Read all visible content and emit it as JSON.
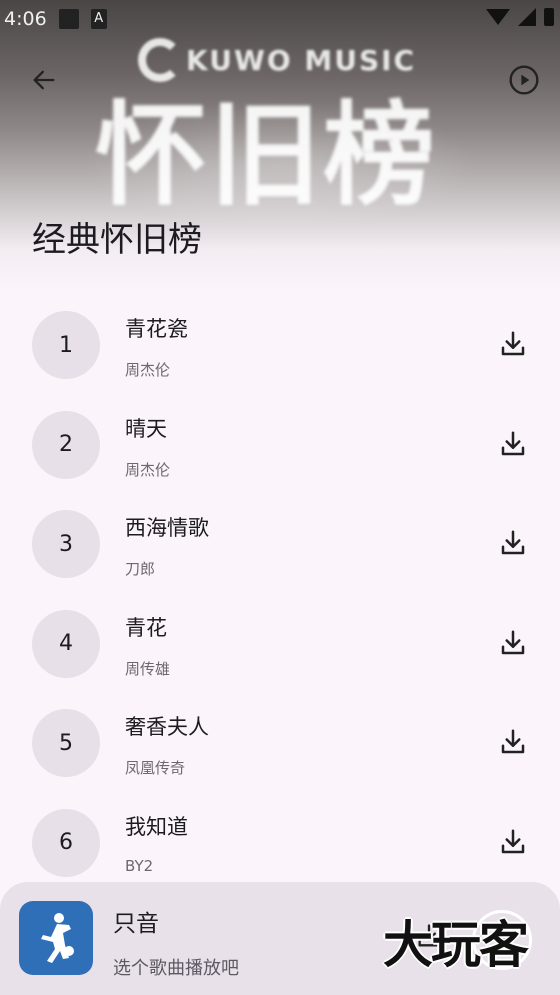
{
  "status_bar": {
    "time": "4:06"
  },
  "banner": {
    "brand": "KUWO MUSIC",
    "art_text": "怀旧榜"
  },
  "page_title": "经典怀旧榜",
  "songs": [
    {
      "rank": "1",
      "title": "青花瓷",
      "artist": "周杰伦"
    },
    {
      "rank": "2",
      "title": "晴天",
      "artist": "周杰伦"
    },
    {
      "rank": "3",
      "title": "西海情歌",
      "artist": "刀郎"
    },
    {
      "rank": "4",
      "title": "青花",
      "artist": "周传雄"
    },
    {
      "rank": "5",
      "title": "奢香夫人",
      "artist": "凤凰传奇"
    },
    {
      "rank": "6",
      "title": "我知道",
      "artist": "BY2"
    }
  ],
  "player": {
    "title": "只音",
    "subtitle": "选个歌曲播放吧"
  },
  "watermark": "大玩客",
  "colors": {
    "rank_bg": "#e7e0e8",
    "cover_bg": "#2f6fb8",
    "player_bg": "#e8e1ea"
  },
  "icons": [
    "back-arrow-icon",
    "play-circle-icon",
    "download-icon",
    "basketball-player-icon"
  ]
}
